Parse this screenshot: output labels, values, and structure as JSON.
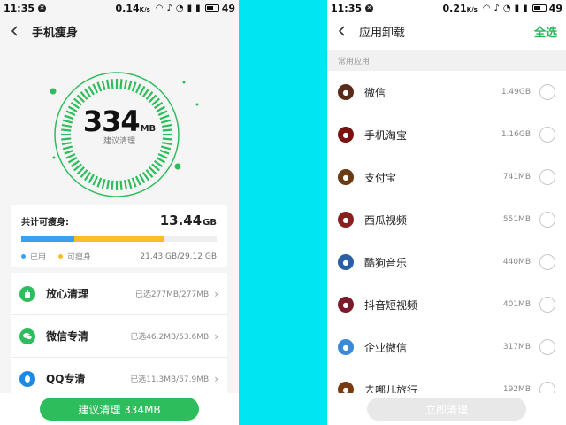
{
  "status_left": {
    "time": "11:35",
    "speed": "0.14",
    "speed_unit": "K/s",
    "battery": "49"
  },
  "status_right": {
    "time": "11:35",
    "speed": "0.21",
    "speed_unit": "K/s",
    "battery": "49"
  },
  "left": {
    "title": "手机瘦身",
    "ring": {
      "value": "334",
      "unit": "MB",
      "caption": "建议清理"
    },
    "summary": {
      "label": "共计可瘦身:",
      "value": "13.44",
      "unit": "GB",
      "used_fraction": 0.27,
      "slim_fraction": 0.46,
      "legend_used": "已用",
      "legend_slim": "可瘦身",
      "storage": "21.43 GB/29.12 GB",
      "colors": {
        "used": "#3aa0f0",
        "slim": "#fbbd25"
      }
    },
    "items": [
      {
        "label": "放心清理",
        "detail": "已选277MB/277MB",
        "icon": "broom-icon"
      },
      {
        "label": "微信专清",
        "detail": "已选46.2MB/53.6MB",
        "icon": "wechat-icon"
      },
      {
        "label": "QQ专清",
        "detail": "已选11.3MB/57.9MB",
        "icon": "qq-icon"
      }
    ],
    "button": "建议清理 334MB",
    "accent": "#2ebd5c"
  },
  "right": {
    "title": "应用卸载",
    "select_all": "全选",
    "section": "常用应用",
    "apps": [
      {
        "name": "微信",
        "size": "1.49GB",
        "color": "#5a2a1a",
        "icon": "wechat-app-icon"
      },
      {
        "name": "手机淘宝",
        "size": "1.16GB",
        "color": "#7a1010",
        "icon": "taobao-app-icon"
      },
      {
        "name": "支付宝",
        "size": "741MB",
        "color": "#6b3a12",
        "icon": "alipay-app-icon"
      },
      {
        "name": "西瓜视频",
        "size": "551MB",
        "color": "#8a1f1f",
        "icon": "xigua-app-icon"
      },
      {
        "name": "酷狗音乐",
        "size": "440MB",
        "color": "#2a5fa8",
        "icon": "kugou-app-icon"
      },
      {
        "name": "抖音短视频",
        "size": "401MB",
        "color": "#7a1a2a",
        "icon": "douyin-app-icon"
      },
      {
        "name": "企业微信",
        "size": "317MB",
        "color": "#3a8ad8",
        "icon": "wecom-app-icon"
      },
      {
        "name": "去哪儿旅行",
        "size": "192MB",
        "color": "#7a3a10",
        "icon": "qunar-app-icon"
      }
    ],
    "button": "立即清理"
  }
}
